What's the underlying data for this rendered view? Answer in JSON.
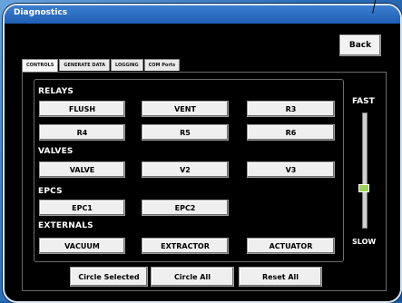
{
  "window": {
    "title": "Diagnostics"
  },
  "header": {
    "back_label": "Back"
  },
  "tabs": [
    {
      "label": "CONTROLS",
      "active": true
    },
    {
      "label": "GENERATE DATA",
      "active": false
    },
    {
      "label": "LOGGING",
      "active": false
    },
    {
      "label": "COM Ports",
      "active": false
    }
  ],
  "sections": {
    "relays": {
      "label": "RELAYS",
      "buttons": [
        "FLUSH",
        "VENT",
        "R3",
        "R4",
        "R5",
        "R6"
      ]
    },
    "valves": {
      "label": "VALVES",
      "buttons": [
        "VALVE",
        "V2",
        "V3"
      ]
    },
    "epcs": {
      "label": "EPCS",
      "buttons": [
        "EPC1",
        "EPC2"
      ]
    },
    "externals": {
      "label": "EXTERNALS",
      "buttons": [
        "VACUUM",
        "EXTRACTOR",
        "ACTUATOR"
      ]
    }
  },
  "footer": {
    "circle_selected": "Circle Selected",
    "circle_all": "Circle All",
    "reset_all": "Reset All"
  },
  "speed": {
    "fast_label": "FAST",
    "slow_label": "SLOW",
    "level": 0.37
  }
}
